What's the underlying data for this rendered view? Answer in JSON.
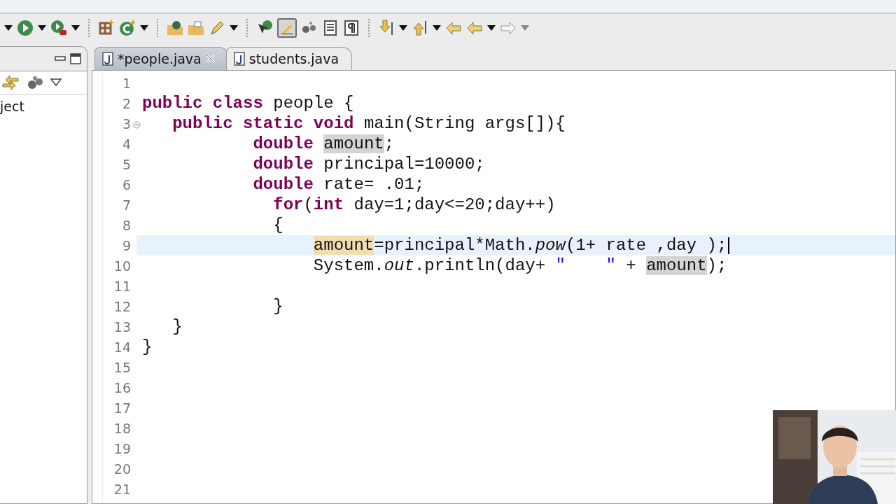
{
  "toolbar": {
    "mark_occurrences": true
  },
  "left_panel": {
    "items": [
      "ject"
    ]
  },
  "tabs": [
    {
      "label": "*people.java",
      "selected": true
    },
    {
      "label": "students.java",
      "selected": false
    }
  ],
  "editor": {
    "lines": [
      {
        "number": "1",
        "current": false,
        "foldable": false
      },
      {
        "number": "2",
        "current": false,
        "foldable": false,
        "tokens": [
          {
            "kind": "keyword",
            "text": "public class"
          },
          {
            "kind": "text",
            "text": " people {"
          }
        ]
      },
      {
        "number": "3",
        "current": false,
        "foldable": true,
        "tokens": [
          {
            "kind": "keyword",
            "text": "   public static void"
          },
          {
            "kind": "text",
            "text": " main(String args[]){"
          }
        ]
      },
      {
        "number": "4",
        "current": false,
        "foldable": false,
        "tokens": [
          {
            "kind": "keyword",
            "text": "           double "
          },
          {
            "kind": "read_mark",
            "text": "amount"
          },
          {
            "kind": "text",
            "text": ";"
          }
        ]
      },
      {
        "number": "5",
        "current": false,
        "foldable": false,
        "tokens": [
          {
            "kind": "keyword",
            "text": "           double"
          },
          {
            "kind": "text",
            "text": " principal=10000;"
          }
        ]
      },
      {
        "number": "6",
        "current": false,
        "foldable": false,
        "tokens": [
          {
            "kind": "keyword",
            "text": "           double"
          },
          {
            "kind": "text",
            "text": " rate= .01;"
          }
        ]
      },
      {
        "number": "7",
        "current": false,
        "foldable": false,
        "tokens": [
          {
            "kind": "keyword",
            "text": "             for"
          },
          {
            "kind": "text",
            "text": "("
          },
          {
            "kind": "keyword",
            "text": "int"
          },
          {
            "kind": "text",
            "text": " day=1;day<=20;day++)"
          }
        ]
      },
      {
        "number": "8",
        "current": false,
        "foldable": false,
        "tokens": [
          {
            "kind": "text",
            "text": "             {"
          }
        ]
      },
      {
        "number": "9",
        "current": true,
        "foldable": false,
        "tokens": [
          {
            "kind": "write_mark",
            "text": "                 amount"
          },
          {
            "kind": "text",
            "text": "=principal*Math."
          },
          {
            "kind": "static",
            "text": "pow"
          },
          {
            "kind": "text",
            "text": "(1+ rate ,day );"
          }
        ]
      },
      {
        "number": "10",
        "current": false,
        "foldable": false,
        "tokens": [
          {
            "kind": "text",
            "text": "                 System."
          },
          {
            "kind": "static",
            "text": "out"
          },
          {
            "kind": "text",
            "text": ".println(day+ "
          },
          {
            "kind": "string",
            "text": "\"    \""
          },
          {
            "kind": "text",
            "text": " + "
          },
          {
            "kind": "read_mark",
            "text": "amount"
          },
          {
            "kind": "text",
            "text": ");"
          }
        ]
      },
      {
        "number": "11",
        "current": false,
        "foldable": false
      },
      {
        "number": "12",
        "current": false,
        "foldable": false,
        "tokens": [
          {
            "kind": "text",
            "text": "             }"
          }
        ]
      },
      {
        "number": "13",
        "current": false,
        "foldable": false,
        "tokens": [
          {
            "kind": "text",
            "text": "   }"
          }
        ]
      },
      {
        "number": "14",
        "current": false,
        "foldable": false,
        "tokens": [
          {
            "kind": "text",
            "text": "}"
          }
        ]
      },
      {
        "number": "15",
        "current": false,
        "foldable": false
      },
      {
        "number": "16",
        "current": false,
        "foldable": false
      },
      {
        "number": "17",
        "current": false,
        "foldable": false
      },
      {
        "number": "18",
        "current": false,
        "foldable": false
      },
      {
        "number": "19",
        "current": false,
        "foldable": false
      },
      {
        "number": "20",
        "current": false,
        "foldable": false
      },
      {
        "number": "21",
        "current": false,
        "foldable": false
      }
    ]
  }
}
